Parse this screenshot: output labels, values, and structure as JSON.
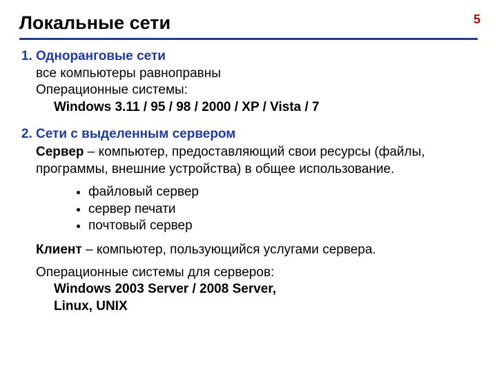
{
  "page_number": "5",
  "title": "Локальные сети",
  "sections": [
    {
      "heading": "Одноранговые сети",
      "line1": "все компьютеры равноправны",
      "line2": "Операционные системы:",
      "os_line": "Windows 3.11 / 95 / 98 / 2000 / XP / Vista / 7"
    },
    {
      "heading": "Сети с выделенным сервером",
      "server_term": "Сервер",
      "server_def": " – компьютер, предоставляющий свои ресурсы (файлы, программы, внешние устройства) в общее использование.",
      "server_types": [
        "файловый сервер",
        "сервер печати",
        "почтовый сервер"
      ],
      "client_term": "Клиент",
      "client_def": " – компьютер, пользующийся услугами сервера.",
      "server_os_label": "Операционные системы для серверов:",
      "server_os_line1": "Windows 2003 Server / 2008 Server,",
      "server_os_line2": "Linux, UNIX"
    }
  ]
}
